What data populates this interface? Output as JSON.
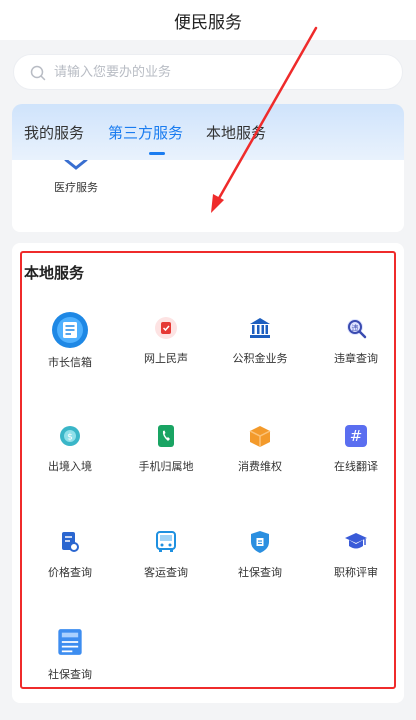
{
  "header": {
    "title": "便民服务"
  },
  "search": {
    "placeholder": "请输入您要办的业务"
  },
  "tabs": [
    {
      "label": "我的服务"
    },
    {
      "label": "第三方服务",
      "active": true
    },
    {
      "label": "本地服务"
    }
  ],
  "third_party": {
    "items": [
      {
        "label": "医疗服务",
        "icon": "medical-icon"
      }
    ]
  },
  "local": {
    "title": "本地服务",
    "items": [
      {
        "label": "市长信箱",
        "icon": "mailbox-icon",
        "color": "#1e88e5"
      },
      {
        "label": "网上民声",
        "icon": "voice-icon",
        "color": "#e53935"
      },
      {
        "label": "公积金业务",
        "icon": "bank-icon",
        "color": "#1e5fbf"
      },
      {
        "label": "违章查询",
        "icon": "violation-search-icon",
        "color": "#3a4bb0"
      },
      {
        "label": "出境入境",
        "icon": "passport-icon",
        "color": "#3ab6c8"
      },
      {
        "label": "手机归属地",
        "icon": "phone-icon",
        "color": "#19a463"
      },
      {
        "label": "消费维权",
        "icon": "consumer-box-icon",
        "color": "#f39a2b"
      },
      {
        "label": "在线翻译",
        "icon": "translate-icon",
        "color": "#5a6ef0"
      },
      {
        "label": "价格查询",
        "icon": "price-search-icon",
        "color": "#2a66d0"
      },
      {
        "label": "客运查询",
        "icon": "bus-icon",
        "color": "#1e90e0"
      },
      {
        "label": "社保查询",
        "icon": "social-security-shield-icon",
        "color": "#2b8fe0"
      },
      {
        "label": "职称评审",
        "icon": "graduation-cap-icon",
        "color": "#3a5bd8"
      },
      {
        "label": "社保查询",
        "icon": "social-security-doc-icon",
        "color": "#3d8df0"
      }
    ]
  },
  "annotation": {
    "highlight_color": "#ef2b2b"
  }
}
